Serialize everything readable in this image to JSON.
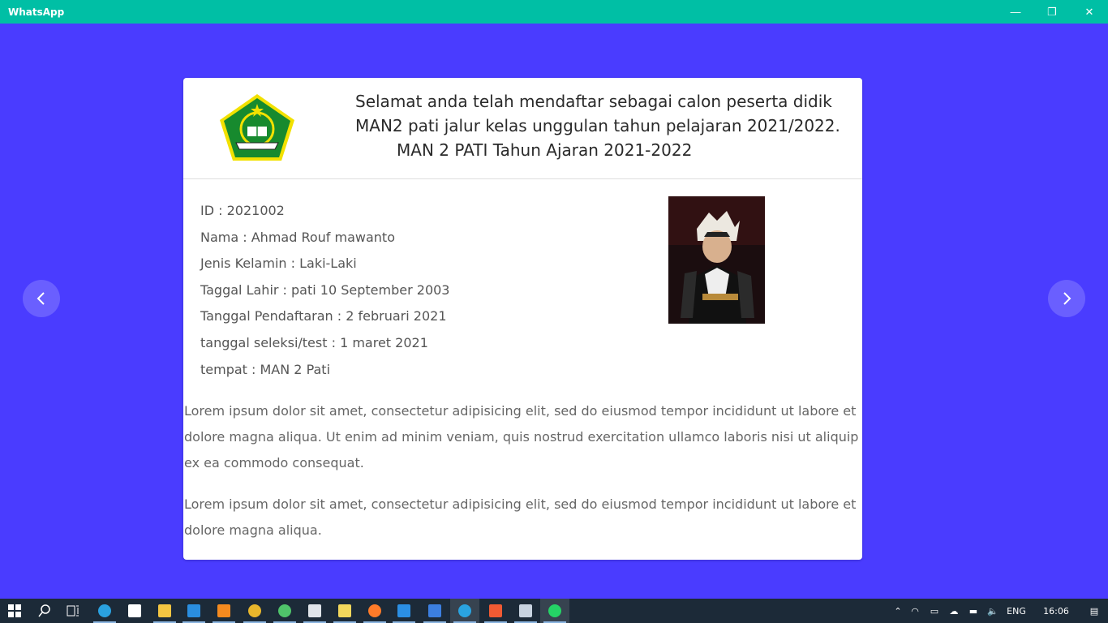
{
  "window": {
    "title": "WhatsApp",
    "minimize": "—",
    "maximize": "❐",
    "close": "✕"
  },
  "card": {
    "heading": [
      "Selamat anda telah mendaftar sebagai calon peserta didik",
      "MAN2 pati jalur kelas unggulan tahun pelajaran 2021/2022.",
      "MAN 2 PATI Tahun Ajaran 2021-2022"
    ],
    "info": [
      "ID : 2021002",
      "Nama : Ahmad Rouf mawanto",
      "Jenis Kelamin : Laki-Laki",
      "Taggal Lahir : pati 10 September 2003",
      "Tanggal Pendaftaran : 2 februari 2021",
      "tanggal seleksi/test : 1 maret 2021",
      "tempat : MAN 2 Pati"
    ],
    "paragraphs": [
      "Lorem ipsum dolor sit amet, consectetur adipisicing elit, sed do eiusmod tempor incididunt ut labore et dolore magna aliqua. Ut enim ad minim veniam, quis nostrud exercitation ullamco laboris nisi ut aliquip ex ea commodo consequat.",
      "Lorem ipsum dolor sit amet, consectetur adipisicing elit, sed do eiusmod tempor incididunt ut labore et dolore magna aliqua."
    ]
  },
  "nav": {
    "prev": "‹",
    "next": "›"
  },
  "taskbar": {
    "icons": [
      {
        "name": "windows-start-icon",
        "color": "#ffffff"
      },
      {
        "name": "search-icon",
        "color": "#ffffff"
      },
      {
        "name": "task-view-icon",
        "color": "#ffffff"
      },
      {
        "name": "edge-icon",
        "color": "#2aa1e0"
      },
      {
        "name": "store-icon",
        "color": "#ffffff"
      },
      {
        "name": "file-explorer-icon",
        "color": "#f4c542"
      },
      {
        "name": "vscode-icon",
        "color": "#2a8ee0"
      },
      {
        "name": "sublime-text-icon",
        "color": "#f58a1f"
      },
      {
        "name": "chrome-icon",
        "color": "#e8b62c"
      },
      {
        "name": "maps-icon",
        "color": "#4fc36a"
      },
      {
        "name": "calendar-icon",
        "color": "#e0e4ea"
      },
      {
        "name": "notepad-icon",
        "color": "#f2d75c"
      },
      {
        "name": "firefox-icon",
        "color": "#ff7b29"
      },
      {
        "name": "mail-icon",
        "color": "#2b8fe4"
      },
      {
        "name": "word-icon",
        "color": "#3c7fe0"
      },
      {
        "name": "telegram-icon",
        "color": "#2aa3e0"
      },
      {
        "name": "git-icon",
        "color": "#f05a33"
      },
      {
        "name": "notes-icon",
        "color": "#c8d3e0"
      },
      {
        "name": "whatsapp-icon",
        "color": "#25d366"
      }
    ],
    "tray": {
      "language": "ENG",
      "time": "16:06"
    }
  }
}
